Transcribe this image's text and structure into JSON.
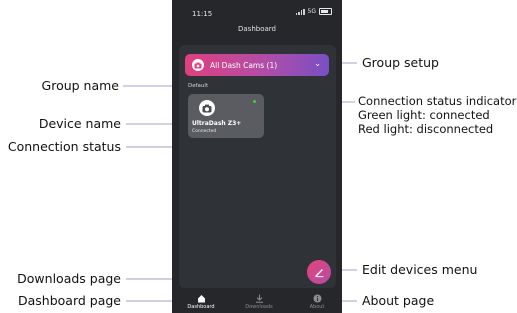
{
  "status_bar": {
    "time": "11:15",
    "network": "5G"
  },
  "header": {
    "title": "Dashboard"
  },
  "group_selector": {
    "label": "All Dash Cams (1)"
  },
  "group": {
    "name": "Default"
  },
  "device": {
    "name": "UltraDash Z3+",
    "status": "Connected",
    "indicator_color": "#3fcf3f"
  },
  "nav": {
    "items": [
      {
        "label": "Dashboard"
      },
      {
        "label": "Downloads"
      },
      {
        "label": "About"
      }
    ]
  },
  "annotations": {
    "group_name": "Group name",
    "device_name": "Device name",
    "connection_status": "Connection status",
    "downloads_page": "Downloads page",
    "dashboard_page": "Dashboard page",
    "group_setup": "Group setup",
    "indicator": [
      "Connection status indicator",
      "Green light: connected",
      "Red light: disconnected"
    ],
    "edit_devices": "Edit devices menu",
    "about_page": "About page"
  },
  "colors": {
    "accent_start": "#e0407e",
    "accent_end": "#7a4fc4",
    "phone_bg": "#25272b"
  }
}
